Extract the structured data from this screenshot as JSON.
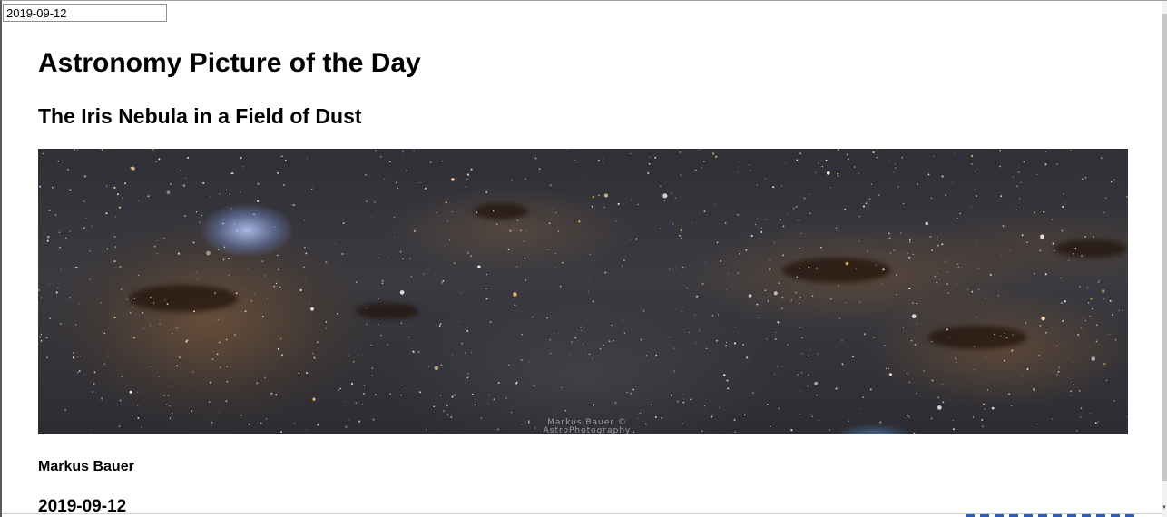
{
  "date_picker": {
    "value": "2019-09-12"
  },
  "header": {
    "title": "Astronomy Picture of the Day"
  },
  "apod": {
    "title": "The Iris Nebula in a Field of Dust",
    "image_alt": "The Iris Nebula in a Field of Dust",
    "watermark_line1": "Markus Bauer ©",
    "watermark_line2": "AstroPhotography",
    "copyright": "Markus Bauer",
    "date": "2019-09-12"
  },
  "colors": {
    "page_background": "#ffffff",
    "text": "#000000",
    "nebula_blue": "#aabeeb",
    "dust_brown": "#78553a",
    "sky": "#34343a"
  }
}
